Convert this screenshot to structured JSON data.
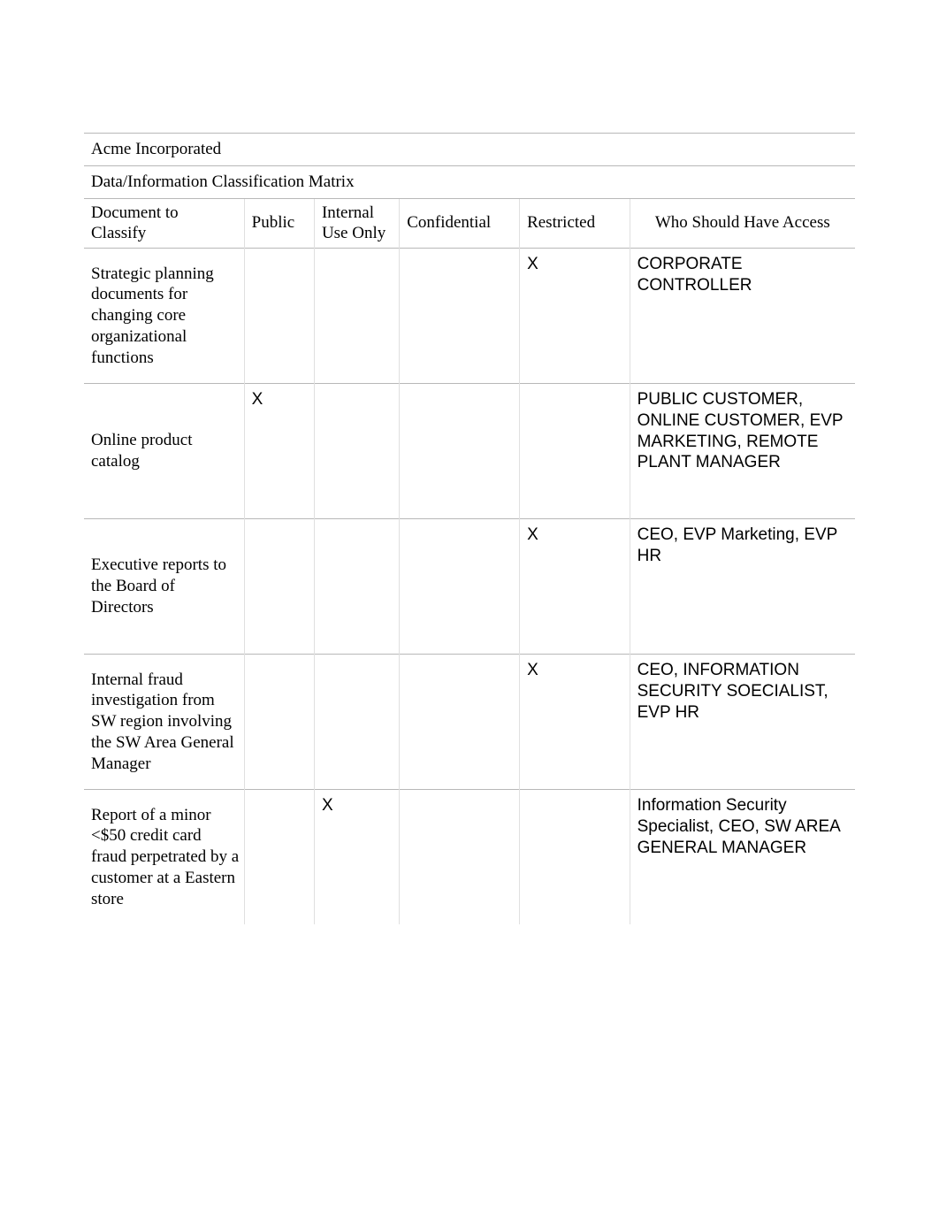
{
  "company": "Acme Incorporated",
  "subtitle": "Data/Information Classification Matrix",
  "columns": {
    "doc": "Document to Classify",
    "public": "Public",
    "internal": "Internal Use Only",
    "confidential": "Confidential",
    "restricted": "Restricted",
    "who": "Who Should Have Access"
  },
  "mark": "X",
  "rows": [
    {
      "doc": "Strategic planning documents for changing core organizational functions",
      "public": "",
      "internal": "",
      "confidential": "",
      "restricted": "X",
      "who": "CORPORATE CONTROLLER"
    },
    {
      "doc": "Online product catalog",
      "public": "X",
      "internal": "",
      "confidential": "",
      "restricted": "",
      "who": "PUBLIC CUSTOMER, ONLINE CUSTOMER, EVP MARKETING, REMOTE PLANT MANAGER"
    },
    {
      "doc": "Executive reports to the Board of Directors",
      "public": "",
      "internal": "",
      "confidential": "",
      "restricted": "X",
      "who": "CEO, EVP Marketing, EVP HR"
    },
    {
      "doc": "Internal fraud investigation from SW region involving the SW Area General Manager",
      "public": "",
      "internal": "",
      "confidential": "",
      "restricted": "X",
      "who": "CEO, INFORMATION SECURITY SOECIALIST, EVP HR"
    },
    {
      "doc": "Report of a minor <$50 credit card fraud perpetrated by a customer at a Eastern store",
      "public": "",
      "internal": "X",
      "confidential": "",
      "restricted": "",
      "who": "Information Security Specialist, CEO, SW AREA GENERAL MANAGER"
    }
  ]
}
